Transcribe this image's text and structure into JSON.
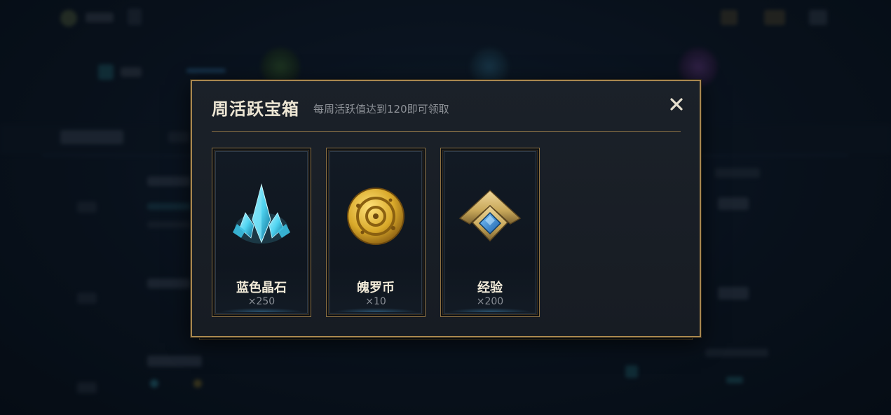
{
  "modal": {
    "title": "周活跃宝箱",
    "subtitle": "每周活跃值达到120即可领取",
    "close_glyph": "✕",
    "rewards": [
      {
        "name": "蓝色晶石",
        "quantity": "×250",
        "icon": "blue-crystal-icon"
      },
      {
        "name": "魄罗币",
        "quantity": "×10",
        "icon": "poro-coin-icon"
      },
      {
        "name": "经验",
        "quantity": "×200",
        "icon": "experience-chevron-icon"
      }
    ]
  },
  "colors": {
    "modal_border": "#a8874f",
    "title": "#ede6d4",
    "subtitle": "#8f9399",
    "crystal": "#4fd3f0",
    "coin": "#d9a92a",
    "exp_gold": "#c9a85a",
    "exp_gem": "#2a8fd8"
  }
}
